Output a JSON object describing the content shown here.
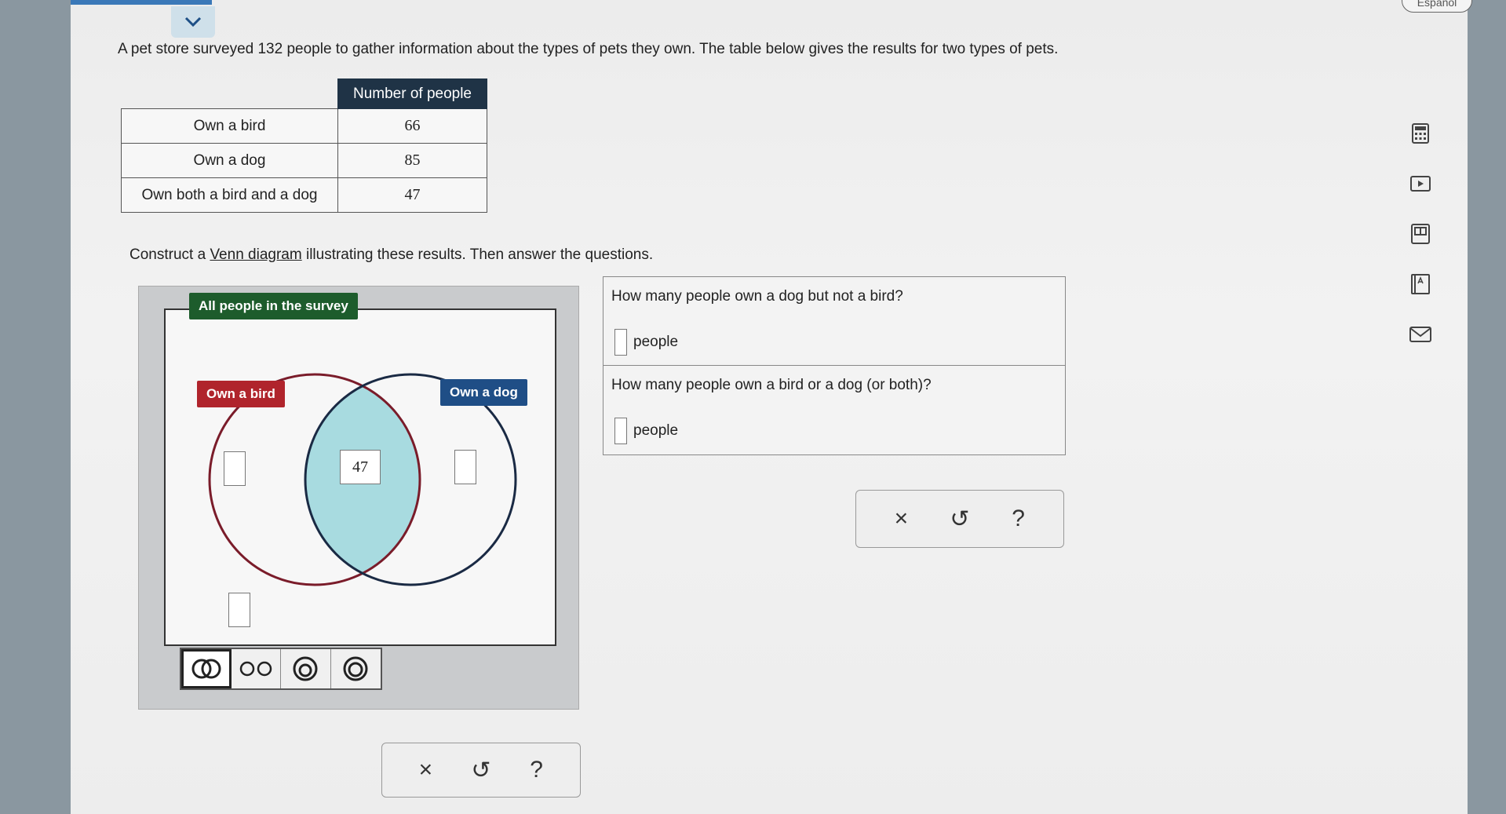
{
  "header": {
    "language_button": "Español"
  },
  "prompt": "A pet store surveyed 132 people to gather information about the types of pets they own. The table below gives the results for two types of pets.",
  "table": {
    "header": "Number of people",
    "rows": [
      {
        "label": "Own a bird",
        "value": "66"
      },
      {
        "label": "Own a dog",
        "value": "85"
      },
      {
        "label": "Own both a bird and a dog",
        "value": "47"
      }
    ]
  },
  "instructions": {
    "before": "Construct a ",
    "link": "Venn diagram",
    "after": " illustrating these results. Then answer the questions."
  },
  "venn": {
    "universe_label": "All people in the survey",
    "set_a_label": "Own a bird",
    "set_b_label": "Own a dog",
    "inputs": {
      "bird_only": "",
      "both": "47",
      "dog_only": "",
      "neither": ""
    },
    "highlight_color": "#a8dbe0",
    "set_a_color": "#7a1c2a",
    "set_b_color": "#1a2a44"
  },
  "questions": [
    {
      "text": "How many people own a dog but not a bird?",
      "unit": "people",
      "value": ""
    },
    {
      "text": "How many people own a bird or a dog (or both)?",
      "unit": "people",
      "value": ""
    }
  ],
  "actions": {
    "clear": "×",
    "undo": "↺",
    "help": "?"
  },
  "side_tools": [
    "calculator-icon",
    "video-icon",
    "textbook-icon",
    "glossary-icon",
    "mail-icon"
  ]
}
